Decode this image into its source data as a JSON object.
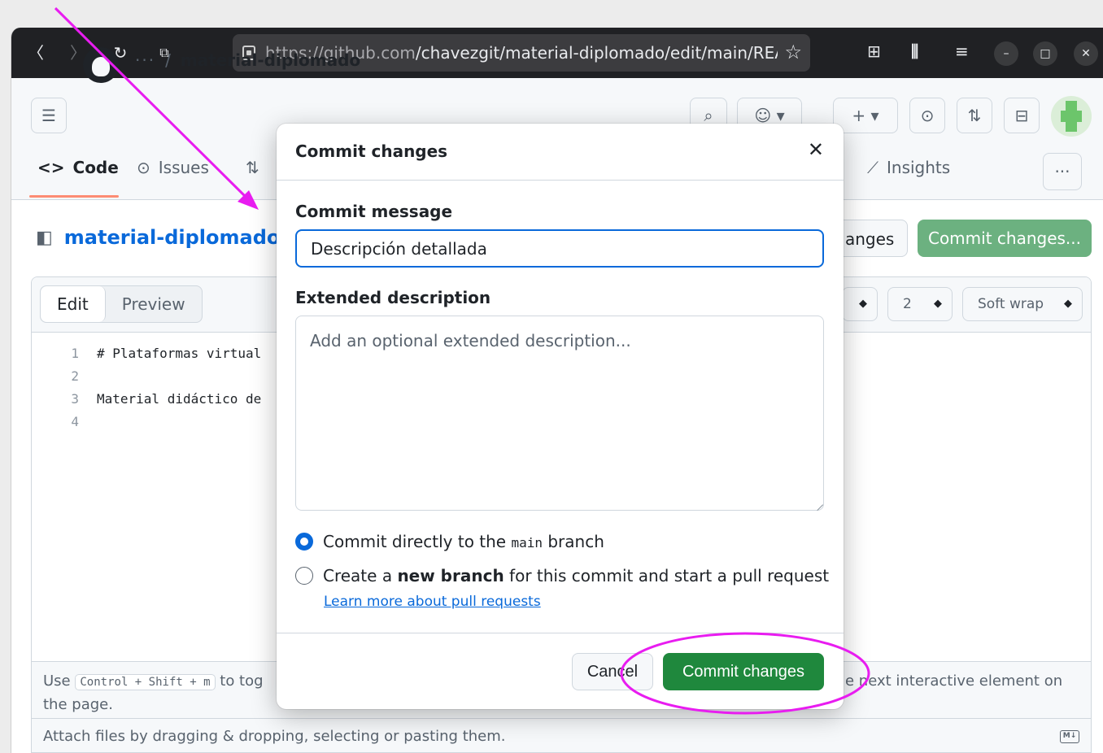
{
  "browser": {
    "url_host": "https://github.com",
    "url_path": "/chavezgit/material-diplomado/edit/main/READ",
    "colors": {
      "chrome": "#202124",
      "urlbar": "#3c3c3f"
    }
  },
  "github": {
    "repo_name": "material-diplomado",
    "tabs": [
      {
        "label": "Code"
      },
      {
        "label": "Issues"
      },
      {
        "label": "Insights"
      }
    ],
    "breadcrumb_repo": "material-diplomado",
    "breadcrumb_sep": "/",
    "cancel_changes_partial": "anges",
    "commit_changes_top": "Commit changes..."
  },
  "editor": {
    "mode_edit": "Edit",
    "mode_preview": "Preview",
    "indent_value": "2",
    "wrap_value": "Soft wrap",
    "lines": [
      {
        "n": "1",
        "text": "# Plataformas virtual"
      },
      {
        "n": "2",
        "text": ""
      },
      {
        "n": "3",
        "text": "Material didáctico de"
      },
      {
        "n": "4",
        "text": ""
      }
    ],
    "footer_use": "Use",
    "footer_key_combo": "Control + Shift + m",
    "footer_toggle": "to tog",
    "footer_page": "the page.",
    "footer_right": "e next interactive element on",
    "attach_text": "Attach files by dragging & dropping, selecting or pasting them.",
    "md_label": "M↓"
  },
  "modal": {
    "title": "Commit changes",
    "commit_message_label": "Commit message",
    "commit_message_value": "Descripción detallada",
    "extended_label": "Extended description",
    "extended_placeholder": "Add an optional extended description...",
    "radio_direct_pre": "Commit directly to the",
    "radio_direct_branch": "main",
    "radio_direct_post": "branch",
    "radio_new_pre": "Create a",
    "radio_new_bold": "new branch",
    "radio_new_post": "for this commit and start a pull request",
    "learn_more": "Learn more about pull requests",
    "cancel_label": "Cancel",
    "commit_label": "Commit changes",
    "selected_option": "direct"
  },
  "colors": {
    "primary_green": "#1f883d",
    "link_blue": "#0969da",
    "annotation_magenta": "#e81cf0"
  },
  "icons": [
    "back-icon",
    "forward-icon",
    "reload-icon",
    "pip-icon",
    "lock-icon",
    "star-icon",
    "extensions-icon",
    "library-icon",
    "menu-icon",
    "minimize-icon",
    "maximize-icon",
    "close-icon",
    "hamburger-icon",
    "github-logo",
    "search-icon",
    "copilot-icon",
    "plus-icon",
    "issues-icon",
    "pull-request-icon",
    "inbox-icon",
    "avatar",
    "code-icon",
    "insights-icon",
    "more-icon",
    "sidebar-toggle-icon",
    "modal-close-icon"
  ]
}
